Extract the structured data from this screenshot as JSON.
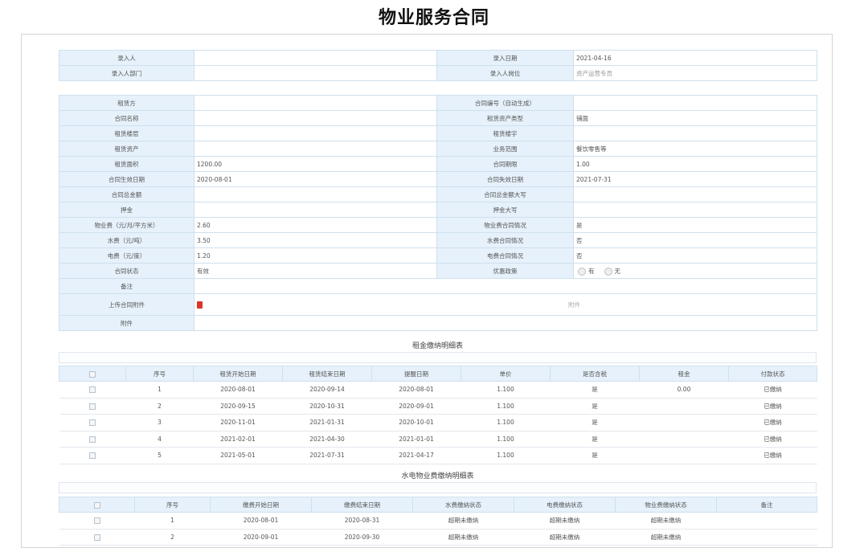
{
  "page": {
    "title": "物业服务合同"
  },
  "entry": {
    "rows": [
      {
        "l1": "录入人",
        "v1": "",
        "l2": "录入日期",
        "v2": "2021-04-16"
      },
      {
        "l1": "录入人部门",
        "v1": "",
        "l2": "录入人岗位",
        "v2": "资产运营专员"
      }
    ]
  },
  "contract": {
    "rows": [
      {
        "l1": "租赁方",
        "v1": "",
        "l2": "合同编号（自动生成）",
        "v2": ""
      },
      {
        "l1": "合同名称",
        "v1": "",
        "l2": "租赁资产类型",
        "v2": "铺面"
      },
      {
        "l1": "租赁楼层",
        "v1": "",
        "l2": "租赁楼宇",
        "v2": ""
      },
      {
        "l1": "租赁资产",
        "v1": "",
        "l2": "业务范围",
        "v2": "餐饮零售等"
      },
      {
        "l1": "租赁面积",
        "v1": "1200.00",
        "l2": "合同期限",
        "v2": "1.00"
      },
      {
        "l1": "合同生效日期",
        "v1": "2020-08-01",
        "l2": "合同失效日期",
        "v2": "2021-07-31"
      },
      {
        "l1": "合同总金额",
        "v1": "",
        "l2": "合同总金额大写",
        "v2": ""
      },
      {
        "l1": "押金",
        "v1": "",
        "l2": "押金大写",
        "v2": ""
      },
      {
        "l1": "物业费（元/月/平方米）",
        "v1": "2.60",
        "l2": "物业费合同情况",
        "v2": "是"
      },
      {
        "l1": "水费（元/吨）",
        "v1": "3.50",
        "l2": "水费合同情况",
        "v2": "否"
      },
      {
        "l1": "电费（元/度）",
        "v1": "1.20",
        "l2": "电费合同情况",
        "v2": "否"
      },
      {
        "l1": "合同状态",
        "v1": "有效",
        "l2": "优惠政策",
        "v2": ""
      }
    ],
    "discount_options": [
      "有",
      "无"
    ],
    "remark_label": "备注",
    "upload_label": "上传合同附件",
    "upload_hint": "附件",
    "attachment_label": "附件"
  },
  "rent": {
    "title": "租金缴纳明细表",
    "columns": [
      "",
      "序号",
      "租赁开始日期",
      "租赁结束日期",
      "提醒日期",
      "单价",
      "是否含税",
      "租金",
      "付款状态"
    ],
    "rows": [
      [
        "1",
        "2020-08-01",
        "2020-09-14",
        "2020-08-01",
        "1.100",
        "是",
        "0.00",
        "已缴纳"
      ],
      [
        "2",
        "2020-09-15",
        "2020-10-31",
        "2020-09-01",
        "1.100",
        "是",
        "",
        "已缴纳"
      ],
      [
        "3",
        "2020-11-01",
        "2021-01-31",
        "2020-10-01",
        "1.100",
        "是",
        "",
        "已缴纳"
      ],
      [
        "4",
        "2021-02-01",
        "2021-04-30",
        "2021-01-01",
        "1.100",
        "是",
        "",
        "已缴纳"
      ],
      [
        "5",
        "2021-05-01",
        "2021-07-31",
        "2021-04-17",
        "1.100",
        "是",
        "",
        "已缴纳"
      ]
    ]
  },
  "utility": {
    "title": "水电物业费缴纳明细表",
    "columns": [
      "",
      "序号",
      "缴费开始日期",
      "缴费结束日期",
      "水费缴纳状态",
      "电费缴纳状态",
      "物业费缴纳状态",
      "备注"
    ],
    "rows": [
      [
        "1",
        "2020-08-01",
        "2020-08-31",
        "超期未缴纳",
        "超期未缴纳",
        "超期未缴纳",
        ""
      ],
      [
        "2",
        "2020-09-01",
        "2020-09-30",
        "超期未缴纳",
        "超期未缴纳",
        "超期未缴纳",
        ""
      ]
    ]
  }
}
